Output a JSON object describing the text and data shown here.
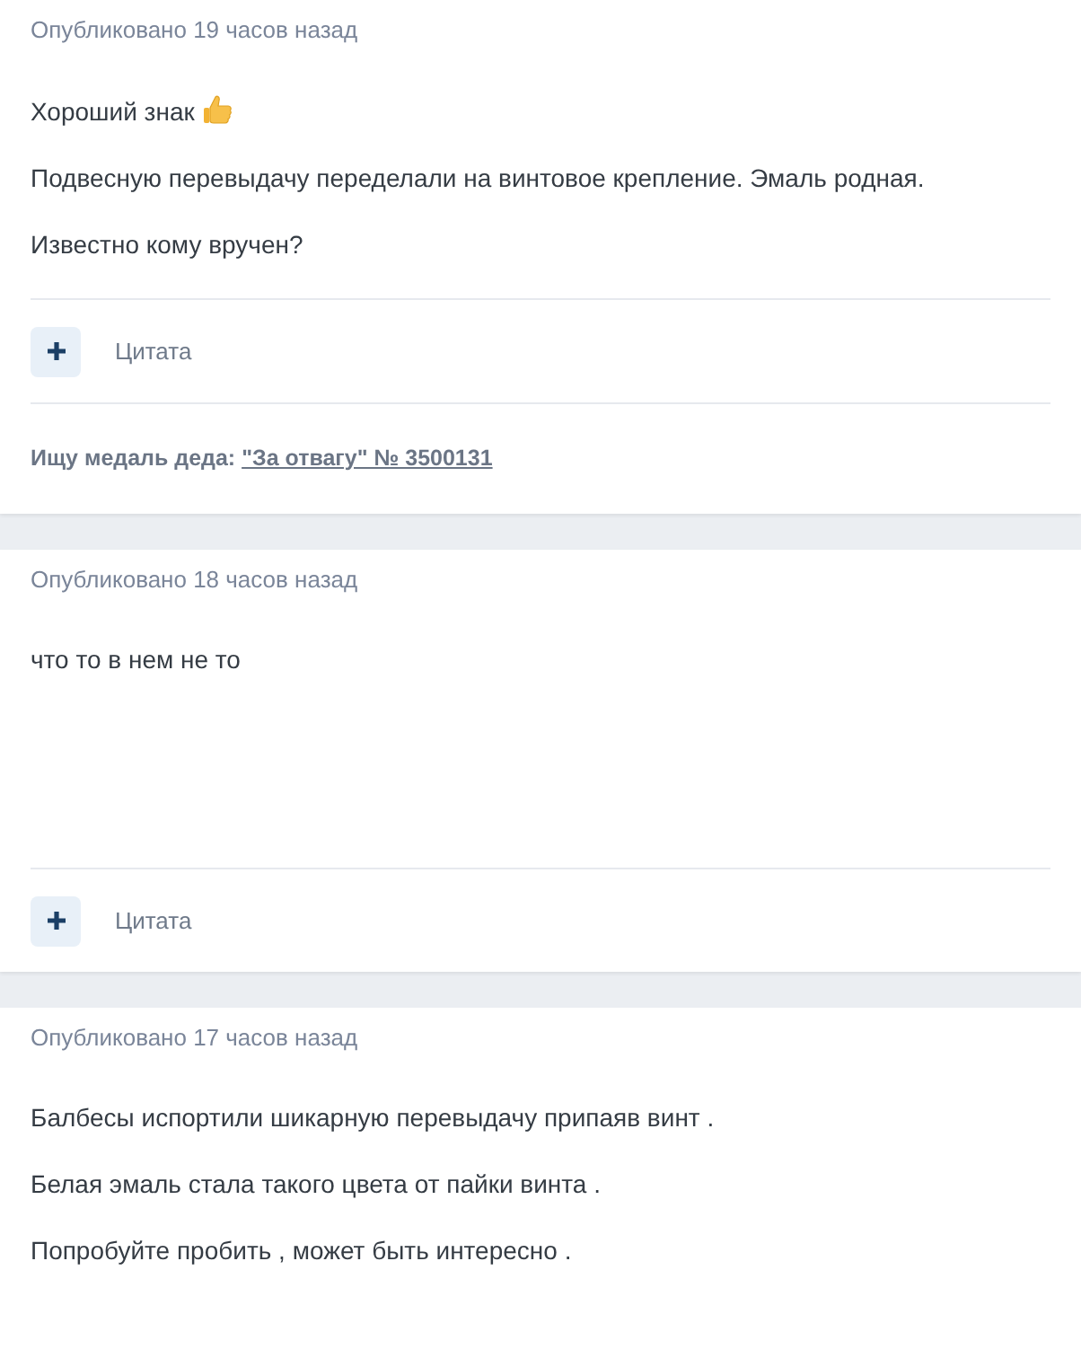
{
  "posts": [
    {
      "meta": "Опубликовано 19 часов назад",
      "paragraphs": [
        {
          "kind": "with_thumb",
          "text": "Хороший знак"
        },
        {
          "kind": "plain",
          "text": "Подвесную перевыдачу переделали на винтовое крепление. Эмаль родная."
        },
        {
          "kind": "plain",
          "text": "Известно кому вручен?"
        }
      ],
      "quote": "Цитата",
      "signature": {
        "label": "Ищу медаль деда:",
        "link": "\"За отвагу\" № 3500131"
      }
    },
    {
      "meta": "Опубликовано 18 часов назад",
      "paragraphs": [
        {
          "kind": "plain",
          "text": "что то в нем не то"
        }
      ],
      "quote": "Цитата"
    },
    {
      "meta": "Опубликовано 17 часов назад",
      "paragraphs": [
        {
          "kind": "plain",
          "text": "Балбесы испортили шикарную перевыдачу припаяв винт ."
        },
        {
          "kind": "plain",
          "text": "Белая эмаль стала такого цвета от пайки винта ."
        },
        {
          "kind": "plain",
          "text": "Попробуйте пробить , может быть интересно ."
        }
      ]
    }
  ]
}
